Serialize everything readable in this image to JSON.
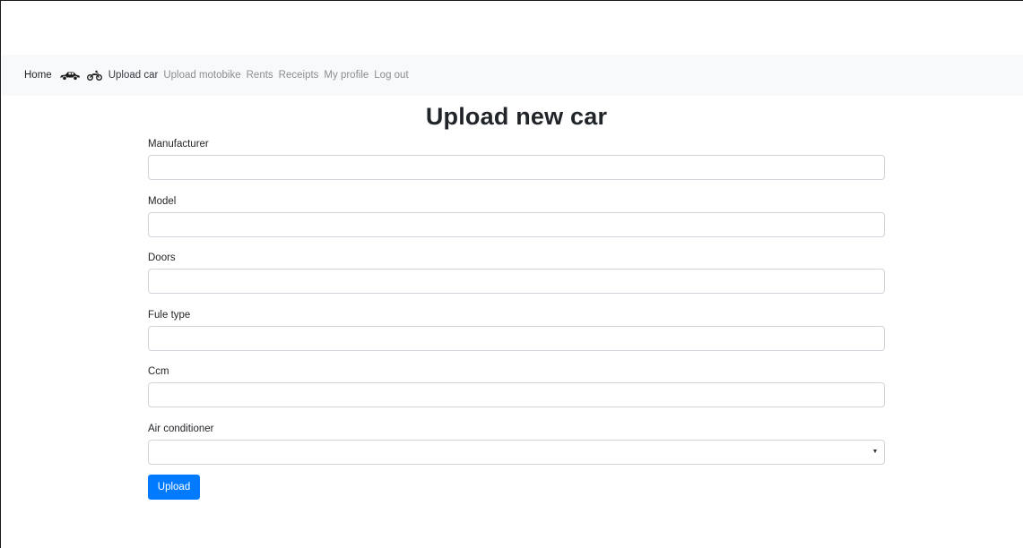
{
  "nav": {
    "home": "Home",
    "car_icon": "car-icon",
    "motorbike_icon": "motorbike-icon",
    "upload_car": "Upload car",
    "upload_motobike": "Upload motobike",
    "rents": "Rents",
    "receipts": "Receipts",
    "my_profile": "My profile",
    "log_out": "Log out"
  },
  "page": {
    "title": "Upload new car"
  },
  "form": {
    "manufacturer": {
      "label": "Manufacturer",
      "value": ""
    },
    "model": {
      "label": "Model",
      "value": ""
    },
    "doors": {
      "label": "Doors",
      "value": ""
    },
    "fuel_type": {
      "label": "Fule type",
      "value": ""
    },
    "ccm": {
      "label": "Ccm",
      "value": ""
    },
    "air_conditioner": {
      "label": "Air conditioner",
      "selected": ""
    },
    "submit_label": "Upload"
  },
  "colors": {
    "navbar_bg": "#f8f9fa",
    "primary_button": "#007bff",
    "input_border": "#ced4da"
  }
}
